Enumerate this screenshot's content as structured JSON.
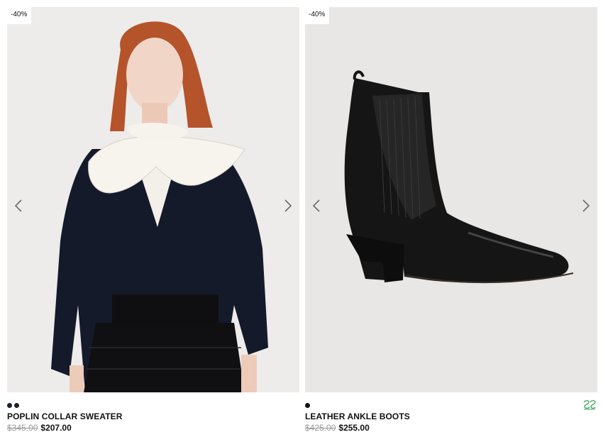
{
  "products": [
    {
      "badge": "-40%",
      "name": "POPLIN COLLAR SWEATER",
      "old_price": "$345.00",
      "new_price": "$207.00",
      "swatch_count": 2
    },
    {
      "badge": "-40%",
      "name": "LEATHER ANKLE BOOTS",
      "old_price": "$425.00",
      "new_price": "$255.00",
      "swatch_count": 1
    }
  ],
  "colors": {
    "swatch": "#1a1f2b",
    "old_price": "#9a9a9a",
    "brand_mark": "#3aa35a"
  },
  "icons": {
    "prev": "chevron-left-icon",
    "next": "chevron-right-icon",
    "brand": "brand-logo-icon"
  }
}
